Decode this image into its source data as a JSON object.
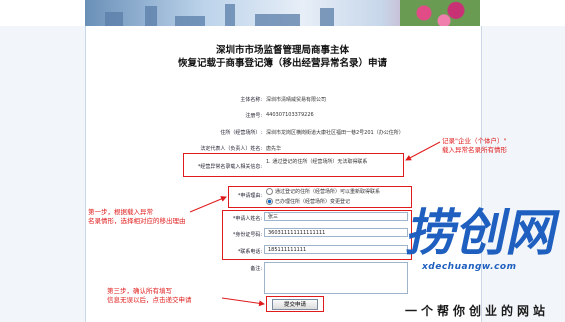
{
  "form": {
    "title_line1": "深圳市市场监督管理局商事主体",
    "title_line2": "恢复记载于商事登记簿（移出经营异常名录）申请",
    "fields": {
      "company_name_label": "主体名称:",
      "company_name_value": "深圳市清晴威贸易有限公司",
      "reg_no_label": "注册号:",
      "reg_no_value": "440307103379226",
      "address_label": "住所（经营场所）:",
      "address_value": "深圳市龙岗区横岗街道大康社区福田一巷2号201（办公住所）",
      "legal_rep_label": "法定代表人（负责人）姓名:",
      "legal_rep_value": "唐先华",
      "abnormal_info_label": "*经营异常名录载入相关信息:",
      "abnormal_info_value": "1.   通过登记的住所（经营场所）无法取得联系",
      "reason_label": "*申请理由:",
      "reason_option1": "通过登记的住所（经营场所）可以重新取得联系",
      "reason_option2": "已办理住所（经营场所）变更登记",
      "applicant_label": "*申请人姓名:",
      "applicant_value": "张三",
      "id_label": "*身份证号码:",
      "id_value": "360311111111111111",
      "phone_label": "*联系电话:",
      "phone_value": "185111111111",
      "remarks_label": "备注:"
    },
    "submit_label": "提交申请"
  },
  "annotations": {
    "right_note_line1": "记录\"企业（个体户）\"",
    "right_note_line2": "载入异常名录所有情形",
    "left_note_line1": "第一步，根据载入异常",
    "left_note_line2": "名录情形，选择相对应的移出理由",
    "bottom_note_line1": "第三步，确认所有填写",
    "bottom_note_line2": "信息无误以后，点击递交申请",
    "color": "#e01b1b"
  },
  "watermark": {
    "logo_text": "捞创网",
    "url": "xdechuangw.com",
    "slogan": "一个帮你创业的网站",
    "accent_color": "#1e5fbf"
  }
}
